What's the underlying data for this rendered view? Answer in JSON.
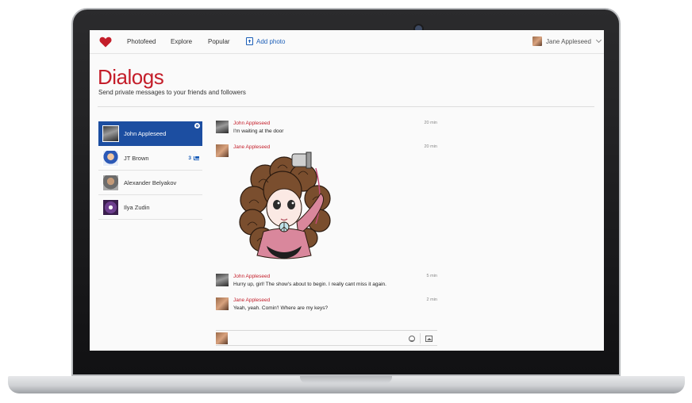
{
  "nav": {
    "items": [
      "Photofeed",
      "Explore",
      "Popular"
    ],
    "add_photo": "Add photo",
    "user_name": "Jane Appleseed"
  },
  "page": {
    "title": "Dialogs",
    "subtitle": "Send private messages to your friends and followers"
  },
  "dialogs": [
    {
      "name": "John Appleseed",
      "active": true
    },
    {
      "name": "JT Brown",
      "unread": "3"
    },
    {
      "name": "Alexander Belyakov"
    },
    {
      "name": "Ilya Zudin"
    }
  ],
  "messages": [
    {
      "author": "John Appleseed",
      "text": "I'm waiting at the door",
      "time": "20 min"
    },
    {
      "author": "Jane Appleseed",
      "text": "",
      "time": "20 min",
      "sticker": "curly-hair-girl-sticker"
    },
    {
      "author": "John Appleseed",
      "text": "Hurry up, girl! The show's about to begin. I really cant miss it again.",
      "time": "5 min"
    },
    {
      "author": "Jane Appleseed",
      "text": "Yeah, yeah. Comin'! Where are my keys?",
      "time": "2 min"
    }
  ],
  "colors": {
    "brand_red": "#c41e2a",
    "active_blue": "#1c4ea1",
    "link_blue": "#1d5fb8"
  }
}
